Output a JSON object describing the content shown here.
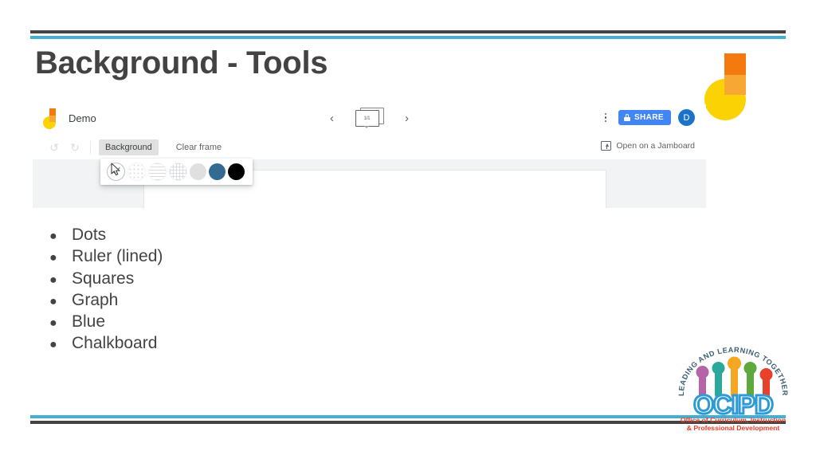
{
  "slide": {
    "title": "Background - Tools",
    "accent_dark": "#434343",
    "accent_cyan": "#45AFD3"
  },
  "jamboard": {
    "app_logo_name": "jamboard-logo",
    "doc_name": "Demo",
    "frame_nav": {
      "prev_label": "‹",
      "next_label": "›",
      "frame_counter": "1/1"
    },
    "overflow_menu_label": "more-options",
    "share_button_label": "SHARE",
    "avatar_initial": "D",
    "toolbar": {
      "undo_label": "↺",
      "redo_label": "↻",
      "background_label": "Background",
      "clear_frame_label": "Clear frame",
      "open_on_jamboard_label": "Open on a Jamboard"
    },
    "background_picker": {
      "swatches": [
        {
          "name": "blank",
          "label": "Blank",
          "color": "#ffffff",
          "selected": true
        },
        {
          "name": "dots",
          "label": "Dots",
          "color": "#ffffff",
          "selected": false
        },
        {
          "name": "lined",
          "label": "Ruler (lined)",
          "color": "#ffffff",
          "selected": false
        },
        {
          "name": "squares",
          "label": "Squares",
          "color": "#ffffff",
          "selected": false
        },
        {
          "name": "graph",
          "label": "Graph",
          "color": "#e0e0e0",
          "selected": false
        },
        {
          "name": "blue",
          "label": "Blue",
          "color": "#336a91",
          "selected": false
        },
        {
          "name": "chalkboard",
          "label": "Chalkboard",
          "color": "#000000",
          "selected": false
        }
      ]
    }
  },
  "bullets": [
    {
      "text": "Dots"
    },
    {
      "text": "Ruler (lined)"
    },
    {
      "text": "Squares"
    },
    {
      "text": "Graph"
    },
    {
      "text": "Blue"
    },
    {
      "text": "Chalkboard"
    }
  ],
  "logo": {
    "arc_text": "LEADING AND LEARNING TOGETHER",
    "acronym": "OCIPD",
    "tagline_line1": "Office of Curriculum, Instruction",
    "tagline_line2": "& Professional Development",
    "figure_colors": [
      "#B565A7",
      "#2BA89B",
      "#F5A623",
      "#5EA83C",
      "#E8402A"
    ],
    "acronym_color": "#2E9BD6",
    "tagline_color": "#E8402A"
  }
}
